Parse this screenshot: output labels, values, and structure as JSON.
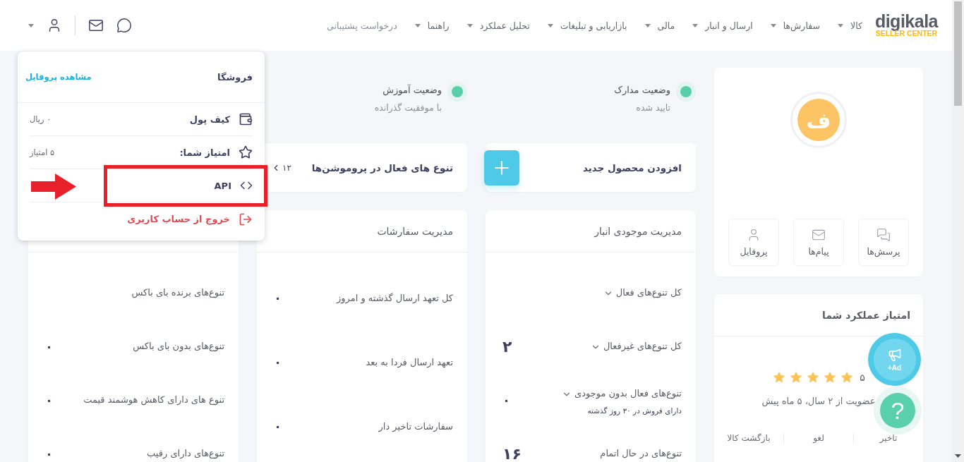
{
  "header": {
    "logo": {
      "name": "digikala",
      "subtitle": "SELLER CENTER"
    },
    "nav": [
      {
        "label": "کالا",
        "dropdown": true
      },
      {
        "label": "سفارش‌ها",
        "dropdown": true
      },
      {
        "label": "ارسال و انبار",
        "dropdown": true
      },
      {
        "label": "مالی",
        "dropdown": true
      },
      {
        "label": "بازاریابی و تبلیغات",
        "dropdown": true
      },
      {
        "label": "تحلیل عملکرد",
        "dropdown": true
      },
      {
        "label": "راهنما",
        "dropdown": true
      },
      {
        "label": "درخواست پشتیبانی",
        "dropdown": false
      }
    ]
  },
  "account_menu": {
    "store_label": "فروشگا",
    "profile_link": "مشاهده پروفایل",
    "items": [
      {
        "kind": "wallet",
        "label": "کیف پول",
        "value": "۰ ریال"
      },
      {
        "kind": "score",
        "label": "امتیاز شما:",
        "value": "۵ امتیاز"
      },
      {
        "kind": "api",
        "label": "API"
      },
      {
        "kind": "logout",
        "label": "خروج از حساب کاربری"
      }
    ]
  },
  "statuses": [
    {
      "title": "وضعیت مدارک",
      "subtitle": "تایید شده"
    },
    {
      "title": "وضعیت آموزش",
      "subtitle": "با موفقیت گذرانده"
    }
  ],
  "quick_cards": [
    {
      "kind": "add",
      "title": "افزودن محصول جدید"
    },
    {
      "kind": "promo",
      "title": "تنوع های فعال در پروموشن‌ها",
      "count": "۱۲"
    }
  ],
  "inventory": {
    "title": "مدیریت موجودی انبار",
    "rows": [
      {
        "label": "کل تنوع‌های فعال",
        "expandable": true
      },
      {
        "label": "کل تنوع‌های غیرفعال",
        "expandable": true,
        "value": "۲"
      },
      {
        "label": "تنوع‌های فعال بدون موجودی",
        "expandable": true,
        "note": "دارای فروش در ۳۰ روز گذشته",
        "value": "۰"
      },
      {
        "label": "تنوع‌های در حال اتمام",
        "expandable": false,
        "value": "۱۶"
      }
    ]
  },
  "orders": {
    "title": "مدیریت سفارشات",
    "rows": [
      {
        "label": "کل تعهد ارسال گذشته و امروز",
        "value": "۰"
      },
      {
        "label": "تعهد ارسال فردا به بعد",
        "value": "۰"
      },
      {
        "label": "سفارشات تاخیر دار",
        "value": "۰"
      }
    ]
  },
  "buybox": {
    "rows": [
      {
        "label": "تنوع‌های برنده بای باکس"
      },
      {
        "label": "تنوع‌های بدون بای باکس",
        "value": "۰"
      },
      {
        "label": "تنوع های دارای کاهش هوشمند قیمت",
        "value": "۰"
      },
      {
        "label": "تنوع‌های دارای رقیب",
        "value": "۰"
      }
    ]
  },
  "profile": {
    "avatar": "ف",
    "shortcuts": [
      {
        "kind": "questions",
        "label": "پرسش‌ها"
      },
      {
        "kind": "messages",
        "label": "پیام‌ها"
      },
      {
        "kind": "profile",
        "label": "پروفایل"
      }
    ]
  },
  "performance": {
    "title": "امتیاز عملکرد شما",
    "stars": 5,
    "score": "۵",
    "membership": "عضویت از ۲ سال، ۵ ماه پیش",
    "stats": [
      "تاخیر",
      "لغو",
      "بازگشت کالا"
    ]
  },
  "floating": {
    "ad_label": "+Ad",
    "help_label": "?"
  }
}
